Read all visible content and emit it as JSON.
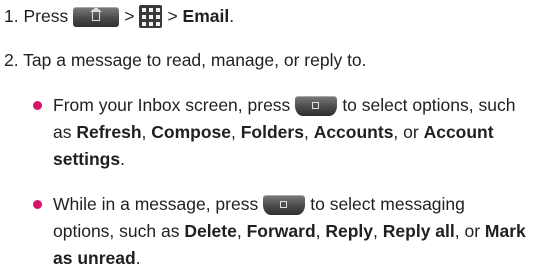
{
  "step1": {
    "prefix": "1. Press",
    "sep1": ">",
    "sep2": "> ",
    "target": "Email",
    "end": "."
  },
  "step2": {
    "text": "2. Tap a message to read, manage, or reply to."
  },
  "bullet1": {
    "lead": "From your Inbox screen, press",
    "after_key": "to select options, such",
    "line2_pre": "as ",
    "opt1": "Refresh",
    "c1": ", ",
    "opt2": "Compose",
    "c2": ", ",
    "opt3": "Folders",
    "c3": ", ",
    "opt4": "Accounts",
    "or": ", or ",
    "opt5a": "Account",
    "opt5b": "settings",
    "end": "."
  },
  "bullet2": {
    "lead": "While in a message, press",
    "after_key": "to select messaging",
    "line2_pre": "options, such as ",
    "opt1": "Delete",
    "c1": ", ",
    "opt2": "Forward",
    "c2": ", ",
    "opt3": "Reply",
    "c3": ", ",
    "opt4": "Reply all",
    "or": ", or ",
    "opt5a": "Mark",
    "opt5b": "as unread",
    "end": "."
  },
  "icons": {
    "home_key": "home-key-icon",
    "apps_key": "applications-grid-icon",
    "menu_key": "menu-key-icon"
  },
  "colors": {
    "bullet": "#d8136a",
    "text": "#231f20",
    "key": "#4a4a4a"
  }
}
